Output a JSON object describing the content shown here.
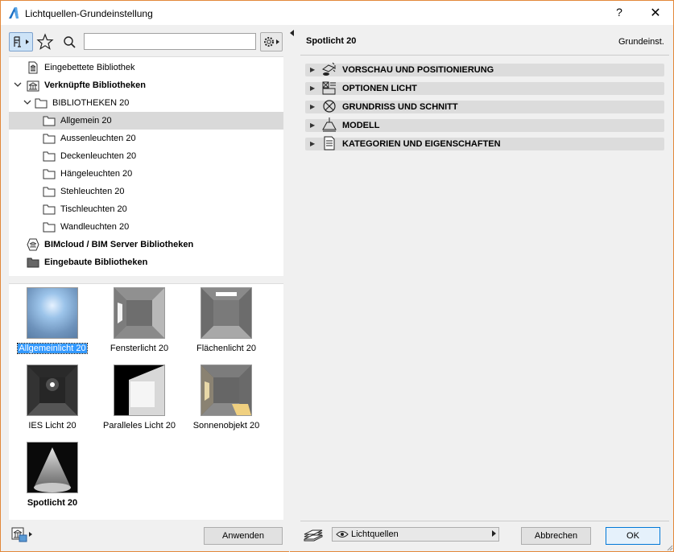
{
  "window": {
    "title": "Lichtquellen-Grundeinstellung",
    "help": "?",
    "close": "✕"
  },
  "left": {
    "search": {
      "value": "",
      "placeholder": ""
    },
    "tree": [
      {
        "label": "Eingebettete Bibliothek",
        "bold": false,
        "icon": "embedded-library-icon"
      },
      {
        "label": "Verknüpfte Bibliotheken",
        "bold": true,
        "icon": "linked-libraries-icon"
      },
      {
        "label": "BIBLIOTHEKEN 20",
        "bold": false,
        "icon": "folder-icon"
      },
      {
        "label": "Allgemein 20",
        "bold": false,
        "icon": "folder-icon",
        "selected": true
      },
      {
        "label": "Aussenleuchten 20",
        "bold": false,
        "icon": "folder-icon"
      },
      {
        "label": "Deckenleuchten 20",
        "bold": false,
        "icon": "folder-icon"
      },
      {
        "label": "Hängeleuchten 20",
        "bold": false,
        "icon": "folder-icon"
      },
      {
        "label": "Stehleuchten 20",
        "bold": false,
        "icon": "folder-icon"
      },
      {
        "label": "Tischleuchten 20",
        "bold": false,
        "icon": "folder-icon"
      },
      {
        "label": "Wandleuchten 20",
        "bold": false,
        "icon": "folder-icon"
      },
      {
        "label": "BIMcloud / BIM Server Bibliotheken",
        "bold": true,
        "icon": "bimcloud-icon"
      },
      {
        "label": "Eingebaute Bibliotheken",
        "bold": true,
        "icon": "folder-dark-icon"
      }
    ],
    "thumbnails": [
      {
        "label": "Allgemeinlicht 20",
        "selected": true
      },
      {
        "label": "Fensterlicht 20"
      },
      {
        "label": "Flächenlicht 20"
      },
      {
        "label": "IES Licht 20"
      },
      {
        "label": "Paralleles Licht 20"
      },
      {
        "label": "Sonnenobjekt 20"
      },
      {
        "label": "Spotlicht 20",
        "bold": true
      }
    ],
    "apply_button": "Anwenden"
  },
  "right": {
    "title": "Spotlicht 20",
    "default_label": "Grundeinst.",
    "sections": [
      {
        "label": "VORSCHAU UND POSITIONIERUNG",
        "icon": "preview-positioning-icon"
      },
      {
        "label": "OPTIONEN LICHT",
        "icon": "light-options-icon"
      },
      {
        "label": "GRUNDRISS UND SCHNITT",
        "icon": "floor-plan-section-icon"
      },
      {
        "label": "MODELL",
        "icon": "model-lamp-icon"
      },
      {
        "label": "KATEGORIEN UND EIGENSCHAFTEN",
        "icon": "categories-properties-icon"
      }
    ],
    "layer_select": "Lichtquellen",
    "cancel_button": "Abbrechen",
    "ok_button": "OK"
  },
  "colors": {
    "window_border": "#e3883a",
    "selection_blue": "#3399ff",
    "ok_border": "#0078d7"
  }
}
